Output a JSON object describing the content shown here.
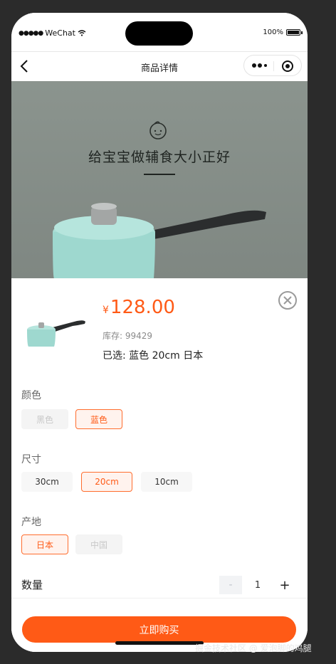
{
  "status_bar": {
    "carrier": "WeChat",
    "battery_text": "100%"
  },
  "nav": {
    "title": "商品详情"
  },
  "banner": {
    "headline": "给宝宝做辅食大小正好"
  },
  "product": {
    "currency": "¥",
    "price": "128.00",
    "stock_text": "库存: 99429",
    "selected_text": "已选: 蓝色 20cm 日本"
  },
  "groups": {
    "color": {
      "label": "颜色",
      "options": [
        "黑色",
        "蓝色"
      ]
    },
    "size": {
      "label": "尺寸",
      "options": [
        "30cm",
        "20cm",
        "10cm"
      ]
    },
    "origin": {
      "label": "产地",
      "options": [
        "日本",
        "中国"
      ]
    }
  },
  "quantity": {
    "label": "数量",
    "minus": "-",
    "value": "1",
    "plus": "+"
  },
  "buy_button": "立即购买",
  "watermark": "掘金技术社区 @ 爱泡脚的鸡腿",
  "colors": {
    "accent": "#ff5a16",
    "banner_bg": "#838b85",
    "pot": "#9ed8cf"
  }
}
